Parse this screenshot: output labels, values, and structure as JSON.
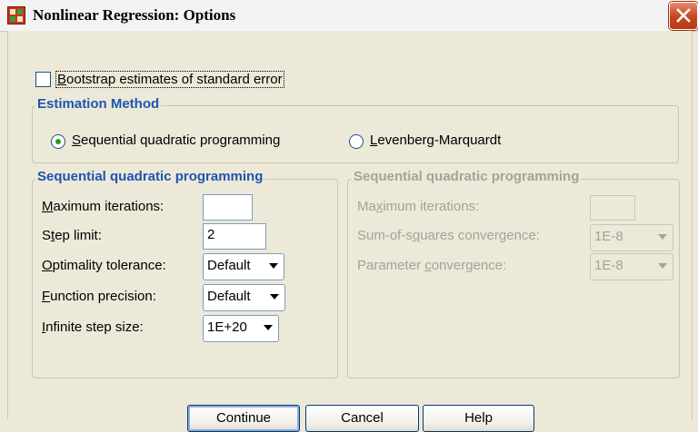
{
  "window": {
    "title": "Nonlinear Regression: Options"
  },
  "bootstrap": {
    "label_pre": "",
    "label_mnemonic": "B",
    "label_post": "ootstrap estimates of standard error",
    "checked": false
  },
  "estimation_method": {
    "legend": "Estimation Method",
    "options": [
      {
        "label_pre": "",
        "label_mnemonic": "S",
        "label_post": "equential quadratic programming",
        "selected": true
      },
      {
        "label_pre": "",
        "label_mnemonic": "L",
        "label_post": "evenberg-Marquardt",
        "selected": false
      }
    ]
  },
  "sqp_left": {
    "legend": "Sequential quadratic programming",
    "max_iterations": {
      "label_pre": "",
      "label_mnemonic": "M",
      "label_post": "aximum iterations:",
      "value": ""
    },
    "step_limit": {
      "label_pre": "S",
      "label_mnemonic": "t",
      "label_post": "ep limit:",
      "value": "2"
    },
    "optimality_tolerance": {
      "label_pre": "",
      "label_mnemonic": "O",
      "label_post": "ptimality tolerance:",
      "value": "Default"
    },
    "function_precision": {
      "label_pre": "",
      "label_mnemonic": "F",
      "label_post": "unction precision:",
      "value": "Default"
    },
    "infinite_step_size": {
      "label_pre": "",
      "label_mnemonic": "I",
      "label_post": "nfinite step size:",
      "value": "1E+20"
    }
  },
  "sqp_right": {
    "legend": "Sequential quadratic programming",
    "max_iterations": {
      "label_pre": "Ma",
      "label_mnemonic": "x",
      "label_post": "imum iterations:",
      "value": ""
    },
    "ss_convergence": {
      "label_pre": "Sum-of-s",
      "label_mnemonic": "q",
      "label_post": "uares convergence:",
      "value": "1E-8"
    },
    "param_convergence": {
      "label_pre": "Parameter ",
      "label_mnemonic": "c",
      "label_post": "onvergence:",
      "value": "1E-8"
    }
  },
  "buttons": {
    "continue": "Continue",
    "cancel": "Cancel",
    "help": "Help"
  },
  "colors": {
    "legend_blue": "#1e55b0",
    "disabled_gray": "#a4a29a",
    "dialog_bg": "#ece9d8"
  }
}
